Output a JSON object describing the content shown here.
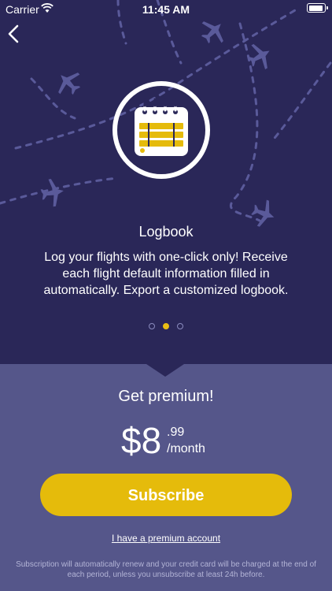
{
  "status_bar": {
    "carrier": "Carrier",
    "time": "11:45 AM"
  },
  "feature": {
    "title": "Logbook",
    "description": "Log your flights with one-click only! Receive each flight default information filled in automatically. Export a customized logbook.",
    "icon": "calendar-icon"
  },
  "pager": {
    "count": 3,
    "active_index": 1
  },
  "premium": {
    "title": "Get premium!",
    "price_dollar": "$8",
    "price_cents": ".99",
    "price_period": "/month",
    "subscribe_label": "Subscribe",
    "account_link": "I have a premium account",
    "fine_print": "Subscription will automatically renew and your credit card will be charged at the end of each period, unless you unsubscribe at least 24h before."
  },
  "colors": {
    "top_bg": "#2a2758",
    "bottom_bg": "#55568a",
    "accent": "#e5bb0b"
  }
}
